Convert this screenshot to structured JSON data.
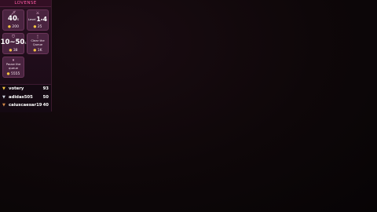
{
  "brand": {
    "title": "LOVENSE"
  },
  "tiles": [
    {
      "icon": "sword-icon",
      "glyph": "🗡",
      "value": "40",
      "unit": "s",
      "price": "200"
    },
    {
      "icon": "sword-icon",
      "glyph": "⚔",
      "mini": "Level",
      "value": "1-4",
      "price": "25"
    },
    {
      "icon": "shield-icon",
      "glyph": "⛉",
      "value": "10~50",
      "unit": "s",
      "price": "38"
    },
    {
      "icon": "toy-icon",
      "glyph": "🕯",
      "label": "Clear the Queue",
      "price": "1K"
    },
    {
      "icon": "pause-icon",
      "glyph": "⏸",
      "label": "Pause the queue",
      "price": "5555"
    }
  ],
  "leaderboard": [
    {
      "rank_icon": "gem-gold-icon",
      "rank_color": "#f5c542",
      "name": "votery",
      "score": "93"
    },
    {
      "rank_icon": "gem-silver-icon",
      "rank_color": "#cfd6e0",
      "name": "adidas505",
      "score": "50"
    },
    {
      "rank_icon": "gem-bronze-icon",
      "rank_color": "#d58a4a",
      "name": "caiuscaesar19",
      "score": "40"
    }
  ]
}
